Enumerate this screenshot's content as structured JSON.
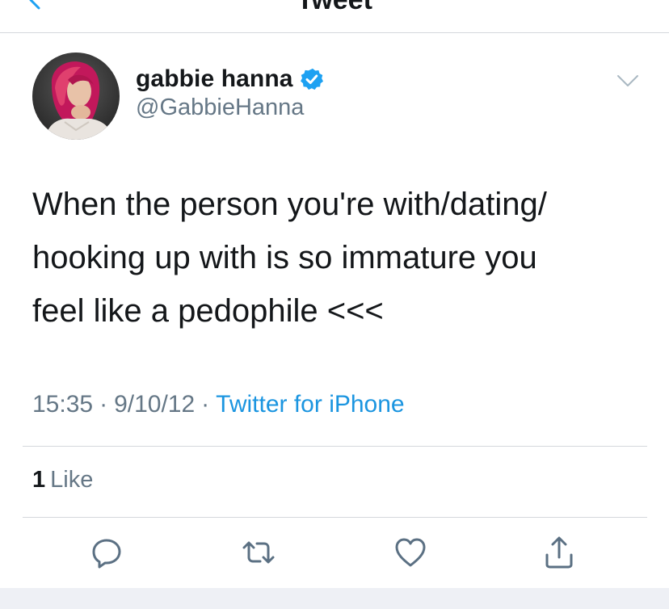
{
  "nav": {
    "title": "Tweet"
  },
  "author": {
    "name": "gabbie hanna",
    "handle": "@GabbieHanna",
    "verified": true
  },
  "tweet": {
    "text": "When the person you're with/dating/\nhooking up with is so immature you\nfeel like a pedophile <<<"
  },
  "meta": {
    "time": "15:35",
    "separator": "·",
    "date": "9/10/12",
    "source": "Twitter for iPhone"
  },
  "stats": {
    "like_count": "1",
    "like_label": "Like"
  },
  "actions": {
    "reply_icon": "reply-icon",
    "retweet_icon": "retweet-icon",
    "like_icon": "heart-icon",
    "share_icon": "share-icon"
  },
  "colors": {
    "accent": "#1b95e0",
    "verified": "#1da1f2",
    "text_primary": "#14171a",
    "text_secondary": "#657786",
    "divider": "#d4d8dc",
    "icon": "#5b7083"
  }
}
